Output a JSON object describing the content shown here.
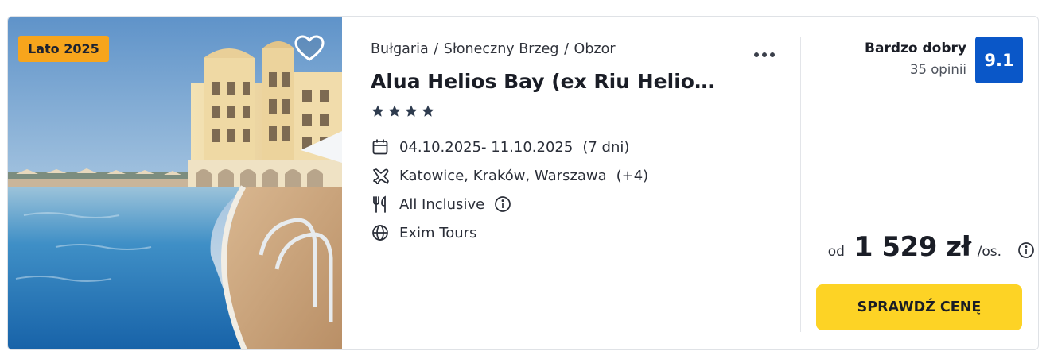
{
  "offer": {
    "season_badge": "Lato 2025",
    "breadcrumb": [
      "Bułgaria",
      "Słoneczny Brzeg",
      "Obzor"
    ],
    "breadcrumb_separator": "/",
    "hotel_name": "Alua Helios Bay (ex Riu Helios ...",
    "stars": 4,
    "dates": "04.10.2025- 11.10.2025",
    "duration": "(7 dni)",
    "departures": "Katowice, Kraków, Warszawa",
    "departures_more": "(+4)",
    "board": "All Inclusive",
    "operator": "Exim Tours",
    "icons": {
      "favorite": "heart-icon",
      "more": "more-dots-icon",
      "dates": "calendar-icon",
      "departures": "airplane-icon",
      "board": "cutlery-icon",
      "operator": "globe-icon",
      "info": "info-icon"
    }
  },
  "rating": {
    "label": "Bardzo dobry",
    "count": "35 opinii",
    "score": "9.1"
  },
  "price": {
    "from_label": "od",
    "amount": "1 529 zł",
    "unit": "/os."
  },
  "cta": {
    "label": "SPRAWDŹ CENĘ"
  },
  "colors": {
    "badge": "#f7a51c",
    "rating_badge": "#0a57c8",
    "cta": "#fdd325"
  }
}
